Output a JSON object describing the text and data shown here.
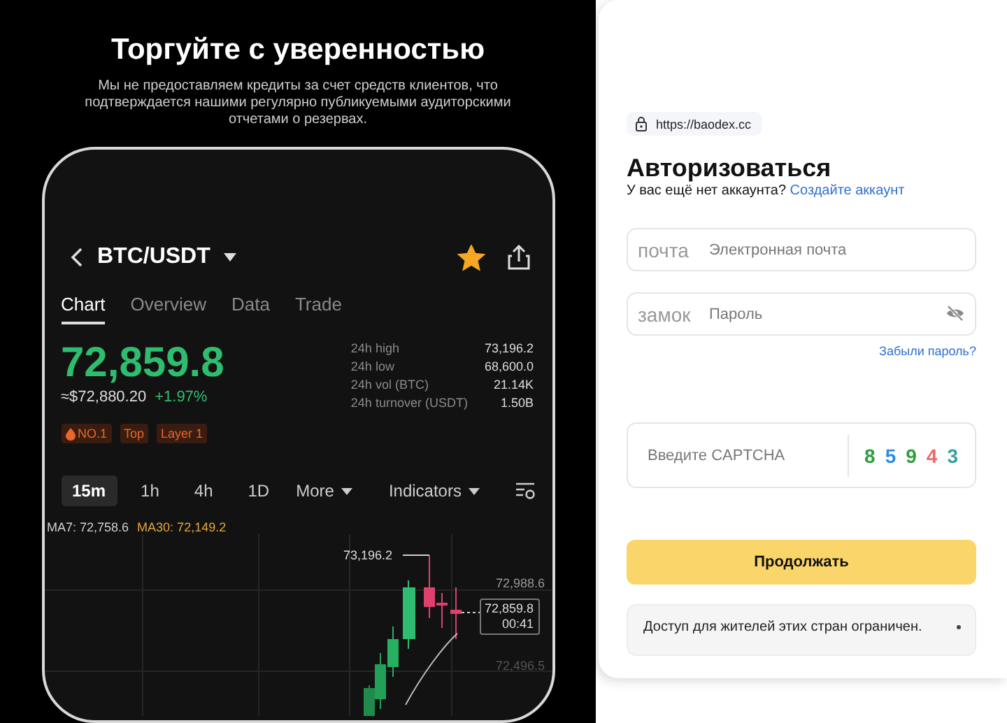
{
  "promo": {
    "title": "Торгуйте с уверенностью",
    "subtitle": "Мы не предоставляем кредиты за счет средств клиентов, что подтверждается нашими регулярно публикуемыми аудиторскими отчетами о резервах."
  },
  "phone": {
    "pair": "BTC/USDT",
    "favorite": true,
    "tabs": [
      {
        "label": "Chart",
        "selected": true
      },
      {
        "label": "Overview",
        "selected": false
      },
      {
        "label": "Data",
        "selected": false
      },
      {
        "label": "Trade",
        "selected": false
      }
    ],
    "price": "72,859.8",
    "usd_price": "≈$72,880.20",
    "change": "+1.97%",
    "stats": [
      {
        "label": "24h high",
        "value": "73,196.2"
      },
      {
        "label": "24h low",
        "value": "68,600.0"
      },
      {
        "label": "24h vol (BTC)",
        "value": "21.14K"
      },
      {
        "label": "24h turnover (USDT)",
        "value": "1.50B"
      }
    ],
    "tags": [
      {
        "text": "NO.1",
        "kind": "hot"
      },
      {
        "text": "Top",
        "kind": "plain"
      },
      {
        "text": "Layer 1",
        "kind": "plain"
      }
    ],
    "timeframes": [
      {
        "label": "15m",
        "selected": true
      },
      {
        "label": "1h",
        "selected": false
      },
      {
        "label": "4h",
        "selected": false
      },
      {
        "label": "1D",
        "selected": false
      }
    ],
    "more": "More",
    "indicators": "Indicators",
    "moving_averages": [
      {
        "label": "MA7: 72,758.6",
        "color": "#d0d0d0"
      },
      {
        "label": "MA30: 72,149.2",
        "color": "#e3a53c"
      }
    ],
    "chart": {
      "high_label": "73,196.2",
      "axis_labels": [
        "72,988.6",
        "72,496.5"
      ],
      "last_price": "72,859.8",
      "countdown": "00:41"
    }
  },
  "login": {
    "url": "https://baodex.cc",
    "title": "Авторизоваться",
    "prompt": "У вас ещё нет аккаунта?",
    "signup_link": "Создайте аккаунт",
    "email": {
      "label": "почта",
      "placeholder": "Электронная почта"
    },
    "password": {
      "label": "замок",
      "placeholder": "Пароль"
    },
    "forgot": "Забыли пароль?",
    "captcha": {
      "placeholder": "Введите CAPTCHA",
      "code": [
        {
          "char": "8",
          "color": "#2e9e3e"
        },
        {
          "char": "5",
          "color": "#2a8be8"
        },
        {
          "char": "9",
          "color": "#2e9e3e"
        },
        {
          "char": "4",
          "color": "#f06a6a"
        },
        {
          "char": "3",
          "color": "#3a9ea0"
        }
      ]
    },
    "submit": "Продолжать",
    "notice": "Доступ для жителей этих стран ограничен."
  }
}
